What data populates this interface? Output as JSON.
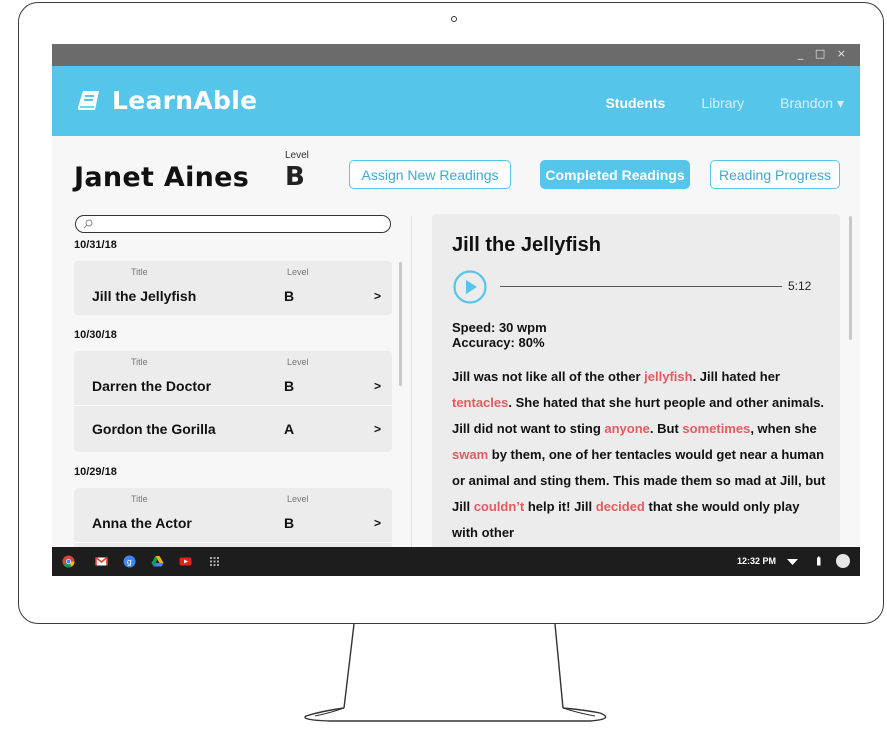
{
  "app": {
    "name": "LearnAble",
    "window_controls": "_ □ ×",
    "brand_color": "#55c5ea"
  },
  "nav": {
    "students": "Students",
    "library": "Library",
    "user": "Brandon ▾"
  },
  "student": {
    "name": "Janet Aines",
    "level_label": "Level",
    "level": "B"
  },
  "actions": {
    "assign": "Assign New Readings",
    "completed": "Completed Readings",
    "progress": "Reading Progress"
  },
  "search": {
    "placeholder": ""
  },
  "list": {
    "col_title": "Title",
    "col_level": "Level",
    "arrow": ">",
    "groups": [
      {
        "date": "10/31/18",
        "items": [
          {
            "title": "Jill the Jellyfish",
            "level": "B"
          }
        ]
      },
      {
        "date": "10/30/18",
        "items": [
          {
            "title": "Darren the Doctor",
            "level": "B"
          },
          {
            "title": "Gordon the Gorilla",
            "level": "A"
          }
        ]
      },
      {
        "date": "10/29/18",
        "items": [
          {
            "title": "Anna the Actor",
            "level": "B"
          }
        ]
      }
    ]
  },
  "reader": {
    "title": "Jill the Jellyfish",
    "duration": "5:12",
    "speed": "Speed:  30 wpm",
    "accuracy": "Accuracy:  80%",
    "story": [
      {
        "t": "Jill was not like all of the other "
      },
      {
        "t": "jellyfish",
        "e": true
      },
      {
        "t": ". Jill hated her "
      },
      {
        "t": "tentacles",
        "e": true
      },
      {
        "t": ". She hated that she hurt people and other animals. Jill did not want to sting "
      },
      {
        "t": "anyone",
        "e": true
      },
      {
        "t": ". But "
      },
      {
        "t": "sometimes",
        "e": true
      },
      {
        "t": ", when she "
      },
      {
        "t": "swam",
        "e": true
      },
      {
        "t": " by them, one of her tentacles would get near a human or animal and sting them. This made them so mad at Jill, but Jill "
      },
      {
        "t": "couldn’t",
        "e": true
      },
      {
        "t": " help it! Jill "
      },
      {
        "t": "decided",
        "e": true
      },
      {
        "t": " that she would only play with other"
      }
    ],
    "error_color": "#e35b62"
  },
  "taskbar": {
    "time": "12:32 PM",
    "icons": [
      "chrome-icon",
      "gmail-icon",
      "google-plus-icon",
      "drive-icon",
      "youtube-icon",
      "apps-grid-icon"
    ]
  }
}
